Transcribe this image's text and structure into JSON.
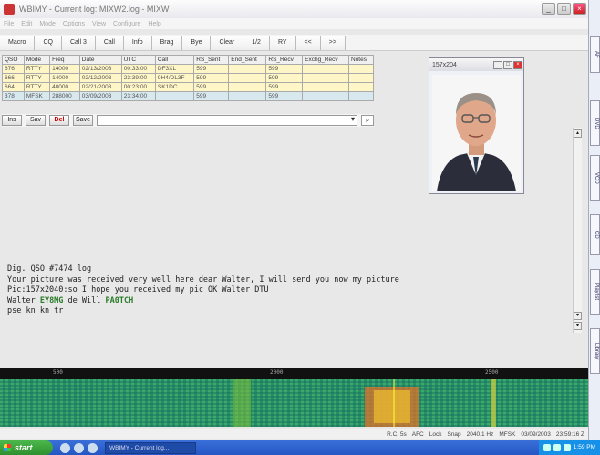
{
  "window": {
    "title": "WBIMY - Current log: MIXW2.log - MIXW",
    "controls": [
      "_",
      "□",
      "×"
    ]
  },
  "menu": [
    "File",
    "Edit",
    "Mode",
    "Options",
    "View",
    "Configure",
    "Help"
  ],
  "toolbar": [
    "Macro",
    "CQ",
    "Call 3",
    "Call",
    "Info",
    "Brag",
    "Bye",
    "Clear",
    "1/2",
    "RY",
    "<<",
    ">>"
  ],
  "log": {
    "columns": [
      "QSO",
      "Mode",
      "Freq",
      "Date",
      "UTC",
      "Call",
      "RS_Sent",
      "End_Sent",
      "RS_Recv",
      "Exchg_Recv",
      "Notes"
    ],
    "rows": [
      [
        "676",
        "RTTY",
        "14000",
        "02/13/2003",
        "00:33:00",
        "DF3XL",
        "599",
        "",
        "599",
        "",
        ""
      ],
      [
        "666",
        "RTTY",
        "14000",
        "02/12/2003",
        "23:39:00",
        "9H4/DL3F",
        "599",
        "",
        "599",
        "",
        ""
      ],
      [
        "664",
        "RTTY",
        "40000",
        "02/21/2003",
        "00:23:00",
        "SK1DC",
        "599",
        "",
        "599",
        "",
        ""
      ],
      [
        "378",
        "MFSK",
        "288000",
        "03/09/2003",
        "23:34:00",
        "",
        "599",
        "",
        "599",
        "",
        ""
      ]
    ]
  },
  "log_tools": {
    "buttons": [
      "Ins",
      "Sav",
      "Del",
      "Save"
    ],
    "search_placeholder": ""
  },
  "photo": {
    "title": "157x204",
    "controls": [
      "_",
      "□",
      "×"
    ]
  },
  "receive_text": {
    "lines": [
      "Dig. QSO #7474 log",
      "Your picture was received very well here dear Walter,  I will send you now my picture",
      "Pic:157x2040:so I hope you received my pic OK Walter DTU",
      "pse kn kn  tr"
    ],
    "signoff_prefix": "Walter ",
    "signoff_call": "EY8MG",
    "signoff_mid": " de Will ",
    "signoff_end": "PA0TCH"
  },
  "waterfall": {
    "freq_labels": [
      "500",
      "2000",
      "2500"
    ]
  },
  "status": {
    "items": [
      "R.C. 5s",
      "AFC",
      "Lock",
      "Snap",
      "2040.1 Hz",
      "MFSK",
      "03/09/2003",
      "23:59:16 Z"
    ]
  },
  "taskbar": {
    "start": "start",
    "task": "WBIMY - Current log...",
    "clock": "1:59 PM"
  },
  "sidebar": {
    "tabs": [
      "AF",
      "DVD",
      "VCD",
      "CD",
      "Playlist",
      "Library"
    ]
  }
}
